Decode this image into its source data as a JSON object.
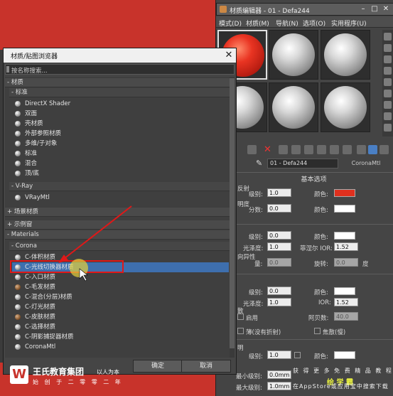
{
  "material_editor": {
    "title": "材质编辑器 - 01 - Defa244",
    "menu": [
      "模式(D)",
      "材质(M)",
      "导航(N)",
      "选项(O)",
      "实用程序(U)"
    ],
    "material_name": "01 - Defa244",
    "material_type": "CoronaMtl",
    "rollout_title": "基本选项",
    "params": {
      "diffuse_label": "反射",
      "level_label": "级别:",
      "level_value": "1.0",
      "color_label": "颜色:",
      "translucency_label": "明度",
      "fraction_label": "分数:",
      "fraction_value": "0.0",
      "reflect_level_value": "0.0",
      "gloss_label": "光泽度:",
      "gloss_value": "1.0",
      "fresnel_label": "菲涅尔 IOR:",
      "fresnel_value": "1.52",
      "aniso_label": "向异性",
      "aniso_amount_label": "量:",
      "aniso_amount_value": "0.0",
      "rotation_label": "旋转:",
      "rotation_value": "0.0",
      "degree_label": "度",
      "refr_level_value": "0.0",
      "refr_gloss_value": "1.0",
      "ior_label": "IOR:",
      "ior_value": "1.52",
      "dispersion_label": "散",
      "enable_label": "启用",
      "abbe_label": "阿贝数:",
      "abbe_value": "40.0",
      "thin_label": "薄(没有折射)",
      "caustics_label": "焦散(慢)",
      "opacity_label": "明",
      "opacity_level_value": "1.0",
      "min_level_label": "最小级别:",
      "min_level_value": "0.0mm",
      "max_level_label": "最大级别:",
      "max_level_value": "1.0mm"
    },
    "colors": {
      "diffuse_swatch": "#e0301e",
      "white_swatch": "#ffffff"
    }
  },
  "browser": {
    "title": "材质/贴图浏览器",
    "search_placeholder": "按名称搜索...",
    "categories": {
      "materials": "- 材质",
      "standard": "- 标准",
      "vray": "- V-Ray",
      "scene": "+ 场景材质",
      "samples": "+ 示例窗",
      "materials_en": "- Materials",
      "corona": "- Corona"
    },
    "standard_items": [
      "DirectX Shader",
      "双面",
      "壳材质",
      "外部参照材质",
      "多维/子对象",
      "标准",
      "混合",
      "顶/底"
    ],
    "vray_items": [
      "VRayMtl"
    ],
    "corona_items": [
      "C-体积材质",
      "C-光线切换器材质",
      "C-入口材质",
      "C-毛发材质",
      "C-混合(分层)材质",
      "C-灯光材质",
      "C-皮肤材质",
      "C-选择材质",
      "C-阴影捕捉器材质",
      "CoronaMtl"
    ],
    "ok_label": "确定",
    "cancel_label": "取消"
  },
  "watermark": {
    "logo": "W",
    "name": "王氏教育集团",
    "tag": "以人为本",
    "sub": "始 创 于 二 零 零 二 年",
    "right_line1": "获 得 更 多 免 费 精 品 教 程",
    "right_logo": "绘 学 霸",
    "right_line2": "在AppStore或应用宝中搜索下载"
  }
}
